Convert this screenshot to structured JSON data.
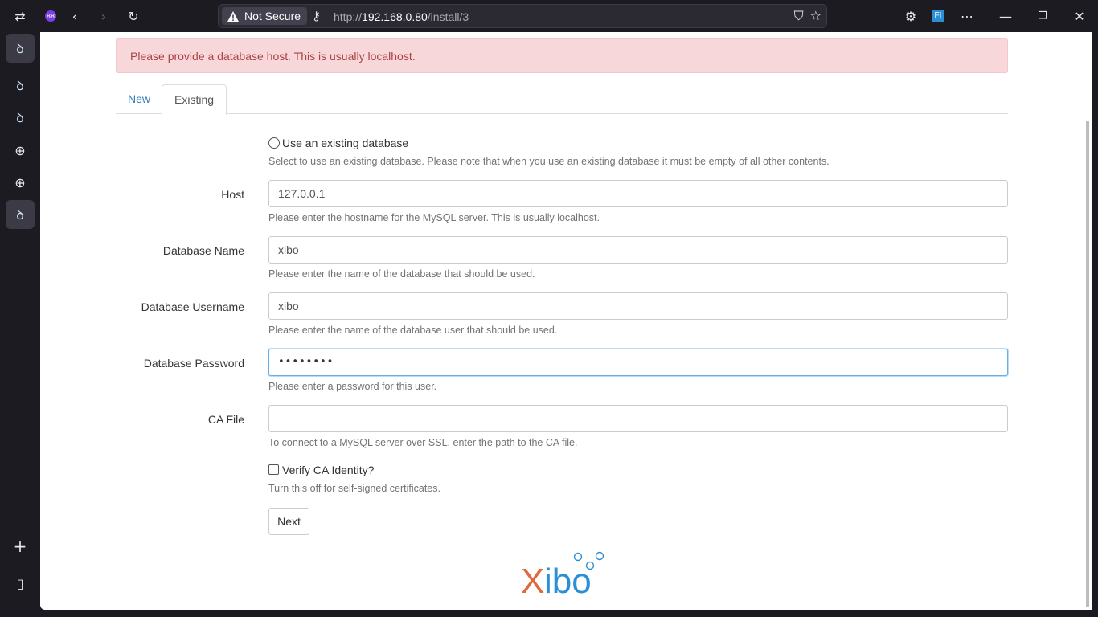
{
  "browser": {
    "security_label": "Not Secure",
    "url_prefix": "http://",
    "url_host": "192.168.0.80",
    "url_path": "/install/3",
    "profile_badge": "FI"
  },
  "alert": {
    "message": "Please provide a database host. This is usually localhost."
  },
  "tabs": [
    {
      "label": "New"
    },
    {
      "label": "Existing"
    }
  ],
  "form": {
    "existing_option_label": "Use an existing database",
    "existing_option_help": "Select to use an existing database. Please note that when you use an existing database it must be empty of all other contents.",
    "host": {
      "label": "Host",
      "value": "127.0.0.1",
      "help": "Please enter the hostname for the MySQL server. This is usually localhost."
    },
    "db_name": {
      "label": "Database Name",
      "value": "xibo",
      "help": "Please enter the name of the database that should be used."
    },
    "db_user": {
      "label": "Database Username",
      "value": "xibo",
      "help": "Please enter the name of the database user that should be used."
    },
    "db_password": {
      "label": "Database Password",
      "value": "••••••••",
      "help": "Please enter a password for this user."
    },
    "ca_file": {
      "label": "CA File",
      "value": "",
      "help": "To connect to a MySQL server over SSL, enter the path to the CA file."
    },
    "verify_ca_label": "Verify CA Identity?",
    "verify_ca_help": "Turn this off for self-signed certificates.",
    "next_label": "Next"
  },
  "logo": {
    "text_x": "X",
    "text_ibo": "ibo"
  },
  "colors": {
    "alert_bg": "#f8d7da",
    "alert_text": "#a94442",
    "link": "#337ab7",
    "logo_orange": "#e06a3b",
    "logo_blue": "#2c8fd6"
  }
}
